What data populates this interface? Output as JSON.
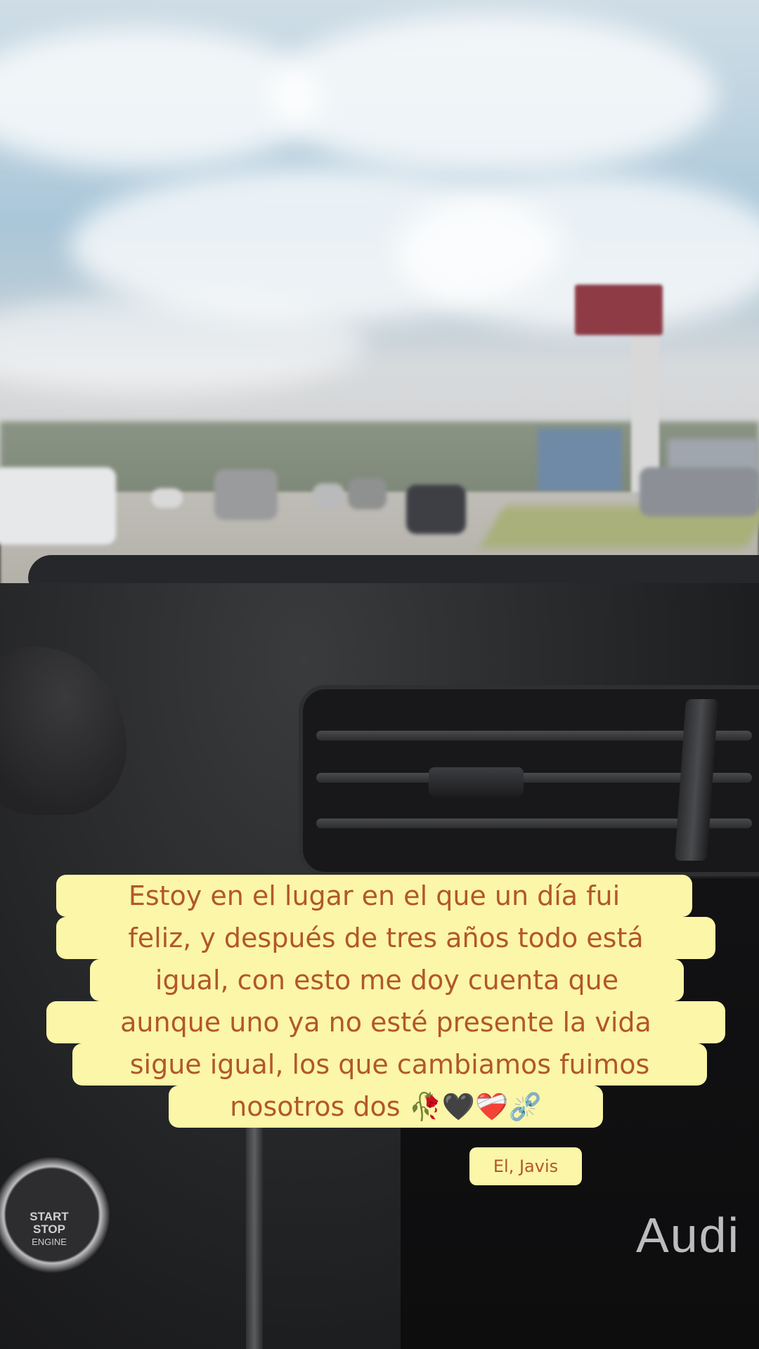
{
  "caption": {
    "lines": [
      "Estoy en el lugar en el que un día fui",
      "feliz, y después de tres años todo está",
      "igual, con esto me doy cuenta que",
      "aunque uno ya no esté presente la vida",
      "sigue igual, los que cambiamos fuimos",
      "nosotros dos 🥀🖤❤️‍🩹⛓️‍💥"
    ],
    "signature": "El, Javis"
  },
  "scene": {
    "audio_label": "Audi",
    "start_button": [
      "START",
      "STOP",
      "ENGINE"
    ]
  },
  "colors": {
    "caption_background": "#fbf6a8",
    "caption_text": "#b2572a"
  }
}
